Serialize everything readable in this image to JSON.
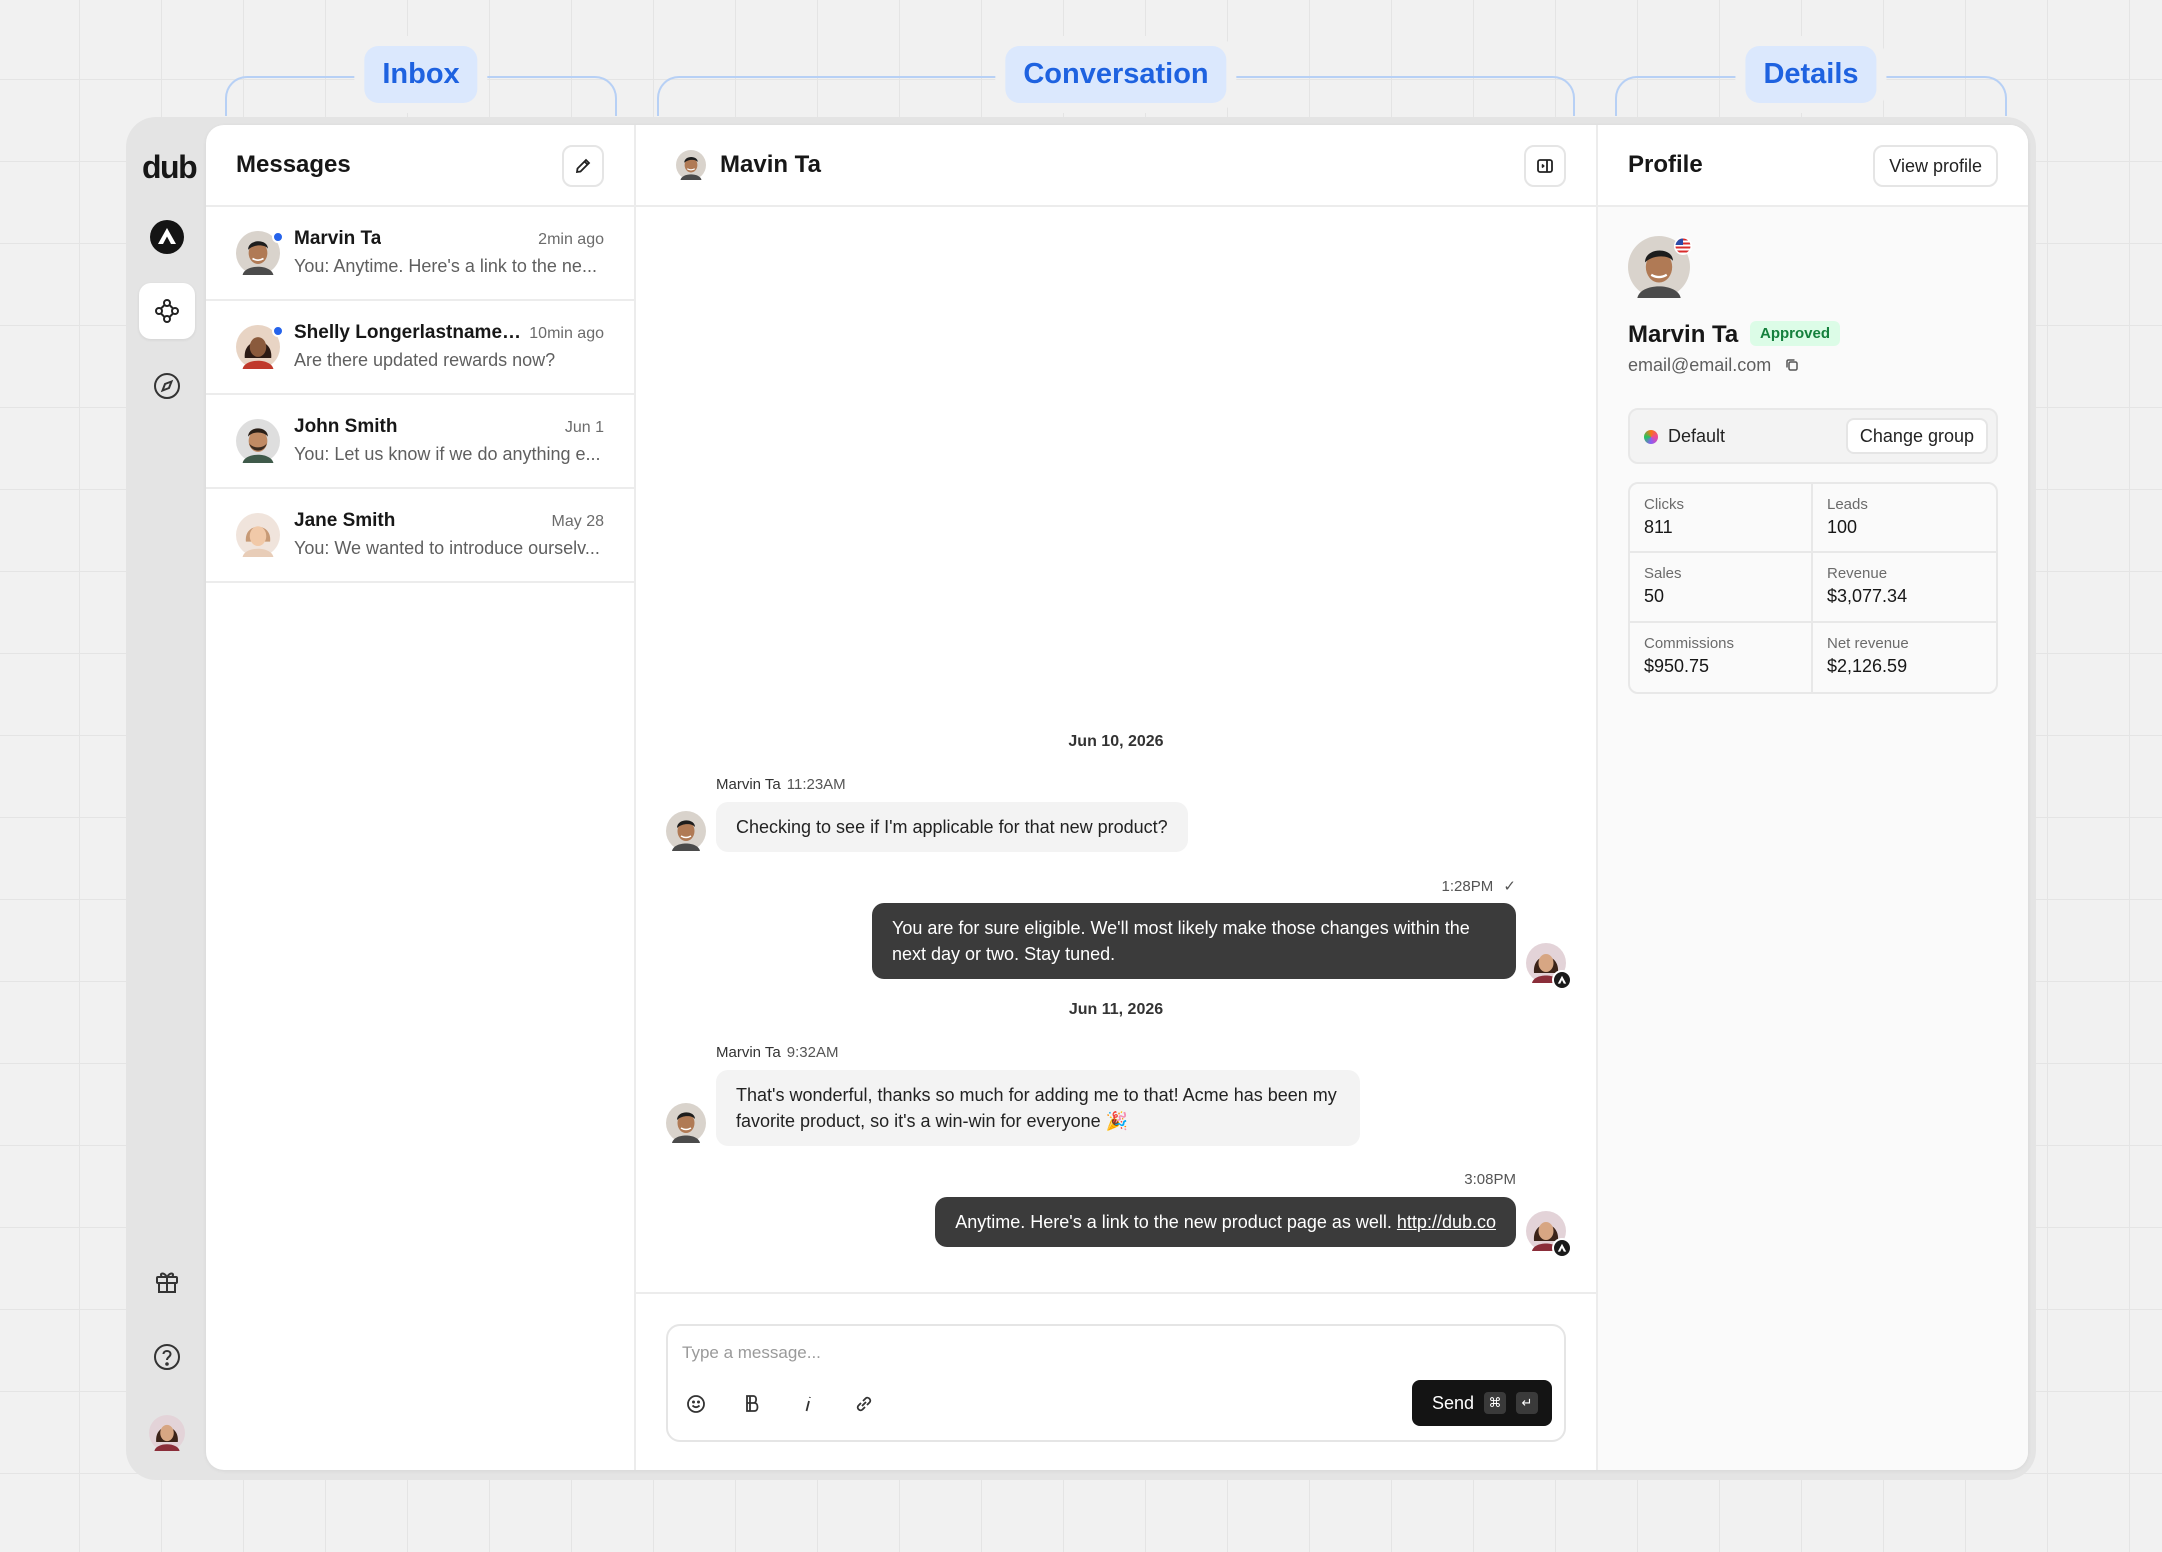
{
  "annotations": {
    "inbox": "Inbox",
    "conversation": "Conversation",
    "details": "Details"
  },
  "app": {
    "logo": "dub"
  },
  "inbox": {
    "title": "Messages",
    "conversations": [
      {
        "name": "Marvin Ta",
        "time": "2min ago",
        "preview": "You: Anytime. Here's a link to the ne...",
        "unread": true
      },
      {
        "name": "Shelly Longerlastnamelik...",
        "time": "10min ago",
        "preview": "Are there updated rewards now?",
        "unread": true
      },
      {
        "name": "John Smith",
        "time": "Jun 1",
        "preview": "You: Let us know if we do anything e...",
        "unread": false
      },
      {
        "name": "Jane Smith",
        "time": "May 28",
        "preview": "You: We wanted to introduce ourselv...",
        "unread": false
      }
    ]
  },
  "conversation": {
    "title": "Mavin Ta",
    "date1": "Jun 10, 2026",
    "date2": "Jun 11, 2026",
    "messages": [
      {
        "sender": "Marvin Ta",
        "time": "11:23AM",
        "text": "Checking to see if I'm applicable for that new product?"
      },
      {
        "time": "1:28PM",
        "check": "✓",
        "text": "You are for sure eligible. We'll most likely make those changes within the next day or two. Stay tuned."
      },
      {
        "sender": "Marvin Ta",
        "time": "9:32AM",
        "text": "That's wonderful, thanks so much for adding me to that! Acme has been my favorite product, so it's a win-win for everyone 🎉"
      },
      {
        "time": "3:08PM",
        "text": "Anytime. Here's a link to the new product page as well.",
        "link": "http://dub.co"
      }
    ],
    "composer": {
      "placeholder": "Type a message...",
      "send_label": "Send",
      "kbd_cmd": "⌘",
      "kbd_enter": "↵"
    }
  },
  "details": {
    "title": "Profile",
    "view_profile": "View profile",
    "name": "Marvin Ta",
    "status": "Approved",
    "email": "email@email.com",
    "group": "Default",
    "change_group": "Change group",
    "stats": [
      {
        "label": "Clicks",
        "value": "811"
      },
      {
        "label": "Leads",
        "value": "100"
      },
      {
        "label": "Sales",
        "value": "50"
      },
      {
        "label": "Revenue",
        "value": "$3,077.34"
      },
      {
        "label": "Commissions",
        "value": "$950.75"
      },
      {
        "label": "Net revenue",
        "value": "$2,126.59"
      }
    ]
  },
  "colors": {
    "accent": "#1e62e0",
    "unread_dot": "#2563eb",
    "approved_bg": "#dcfce7",
    "approved_text": "#15803d",
    "outgoing_bubble": "#3b3b3b"
  }
}
